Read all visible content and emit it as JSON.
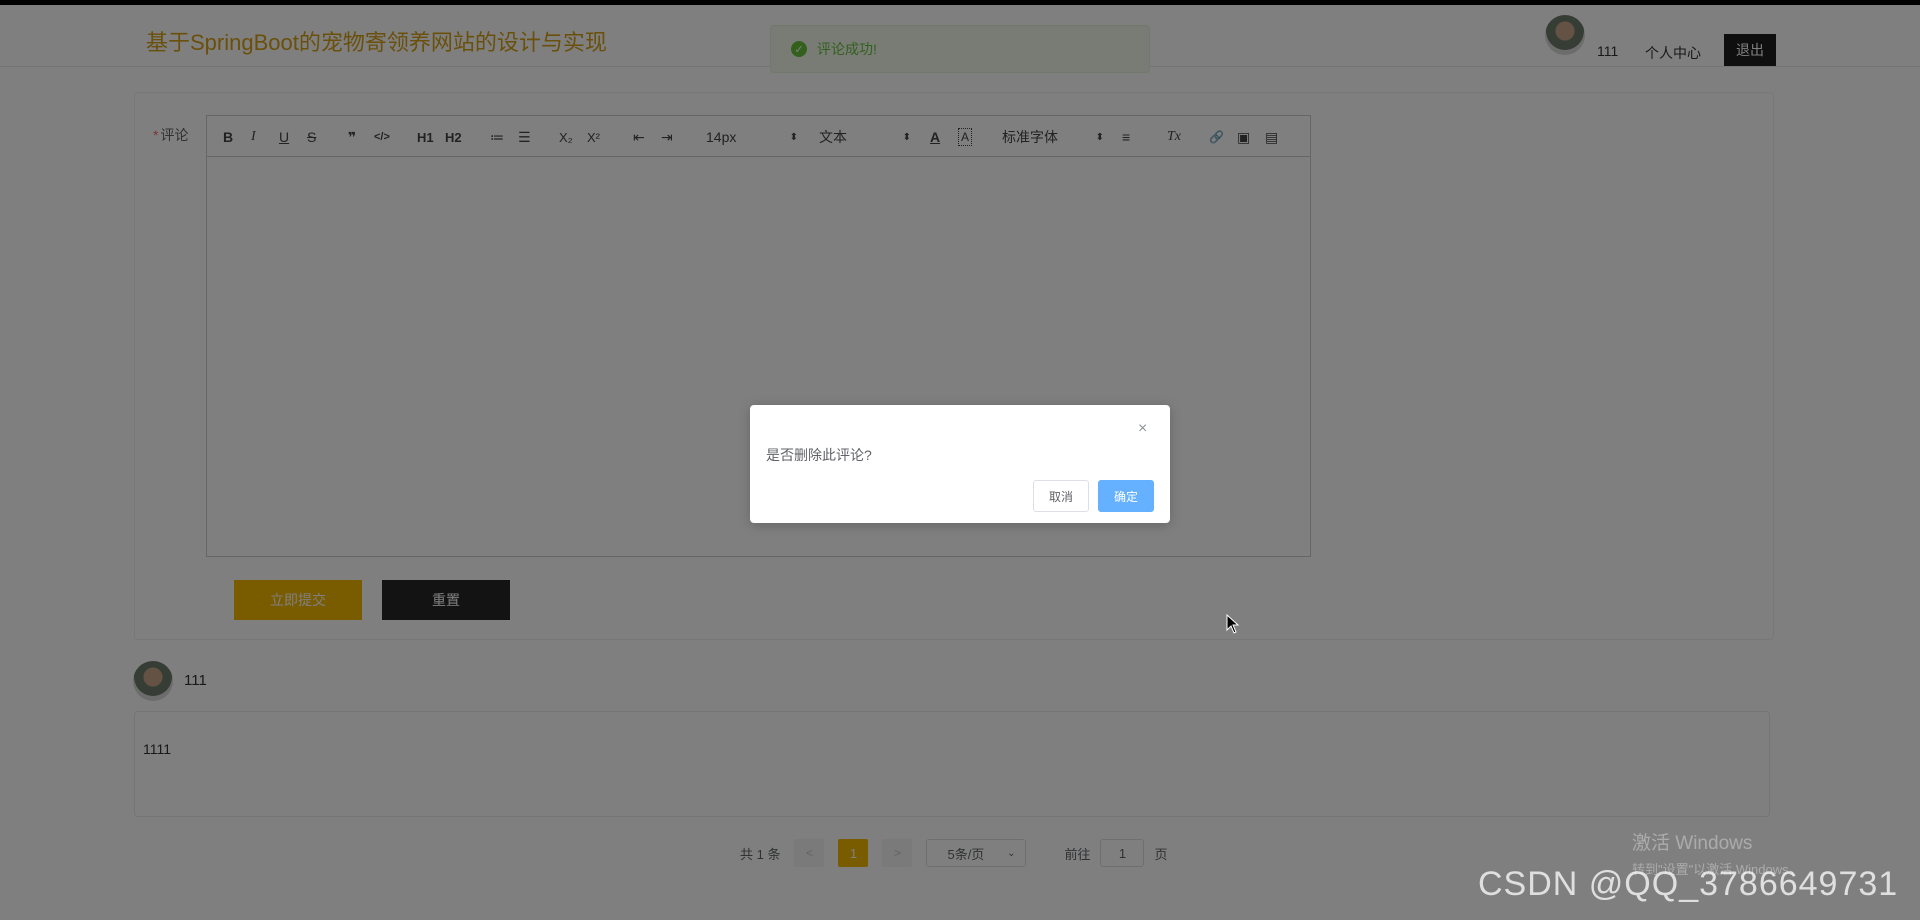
{
  "header": {
    "site_title": "基于SpringBoot的宠物寄领养网站的设计与实现",
    "username": "111",
    "user_center": "个人中心",
    "logout": "退出"
  },
  "page_hint": "%评论",
  "toast": {
    "message": "评论成功!"
  },
  "form": {
    "required_mark": "*",
    "comment_label": "评论",
    "toolbar": {
      "bold": "B",
      "italic": "I",
      "underline": "U",
      "strike": "S",
      "blockquote": "❞",
      "code": "</>",
      "h1": "H1",
      "h2": "H2",
      "ordered_list": "≔",
      "bullet_list": "☰",
      "subscript": "X₂",
      "superscript": "X²",
      "outdent": "⇤",
      "indent": "⇥",
      "font_size": "14px",
      "text_type": "文本",
      "font_color": "A",
      "background_color": "A",
      "font_family": "标准字体",
      "align": "≡",
      "clear_format": "Tx",
      "link": "🔗",
      "image": "▣",
      "video": "▤"
    },
    "submit": "立即提交",
    "reset": "重置"
  },
  "comments": [
    {
      "user": "111",
      "content": "1111"
    }
  ],
  "pagination": {
    "total": "共 1 条",
    "prev": "<",
    "current_page": "1",
    "next": ">",
    "page_size": "5条/页",
    "goto_label": "前往",
    "goto_value": "1",
    "page_suffix": "页"
  },
  "dialog": {
    "message": "是否删除此评论?",
    "close": "×",
    "cancel": "取消",
    "confirm": "确定"
  },
  "watermarks": {
    "windows_line1": "激活 Windows",
    "windows_line2": "转到\"设置\"以激活 Windows。",
    "csdn": "CSDN @QQ_3786649731"
  },
  "colors": {
    "brand_yellow": "#f5b800",
    "title_gold": "#d4a017",
    "dark_button": "#262626",
    "success_green": "#67c23a",
    "confirm_blue": "#66b1ff"
  }
}
